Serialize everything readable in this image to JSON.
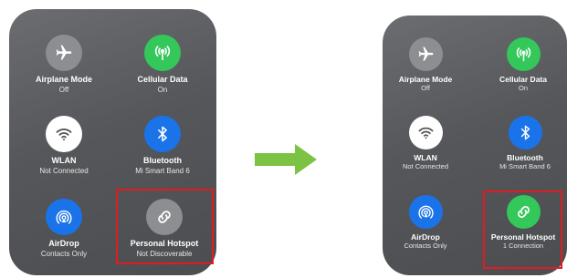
{
  "colors": {
    "accent_green": "#34c759",
    "accent_blue": "#1a73e8",
    "highlight_red": "#e11b22",
    "arrow_green": "#7cc243"
  },
  "before": {
    "airplane": {
      "label": "Airplane Mode",
      "status": "Off",
      "icon": "airplane-icon"
    },
    "cellular": {
      "label": "Cellular Data",
      "status": "On",
      "icon": "antenna-icon"
    },
    "wlan": {
      "label": "WLAN",
      "status": "Not Connected",
      "icon": "wifi-icon"
    },
    "bluetooth": {
      "label": "Bluetooth",
      "status": "Mi Smart Band 6",
      "icon": "bluetooth-icon"
    },
    "airdrop": {
      "label": "AirDrop",
      "status": "Contacts Only",
      "icon": "airdrop-icon"
    },
    "hotspot": {
      "label": "Personal Hotspot",
      "status": "Not Discoverable",
      "icon": "link-icon"
    }
  },
  "after": {
    "airplane": {
      "label": "Airplane Mode",
      "status": "Off",
      "icon": "airplane-icon"
    },
    "cellular": {
      "label": "Cellular Data",
      "status": "On",
      "icon": "antenna-icon"
    },
    "wlan": {
      "label": "WLAN",
      "status": "Not Connected",
      "icon": "wifi-icon"
    },
    "bluetooth": {
      "label": "Bluetooth",
      "status": "Mi Smart Band 6",
      "icon": "bluetooth-icon"
    },
    "airdrop": {
      "label": "AirDrop",
      "status": "Contacts Only",
      "icon": "airdrop-icon"
    },
    "hotspot": {
      "label": "Personal Hotspot",
      "status": "1 Connection",
      "icon": "link-icon"
    }
  }
}
